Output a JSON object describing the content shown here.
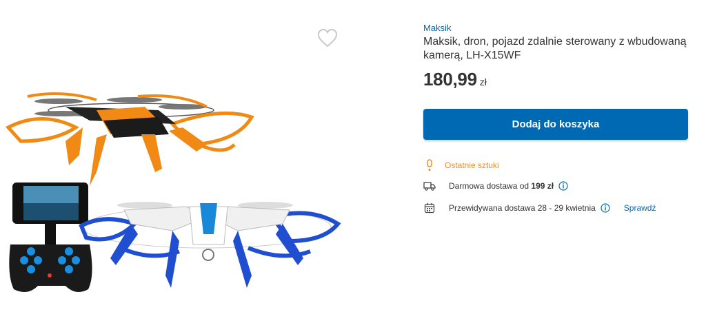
{
  "product": {
    "brand": "Maksik",
    "title": "Maksik, dron, pojazd zdalnie sterowany z wbudowaną kamerą, LH-X15WF",
    "price": "180,99",
    "currency": "zł"
  },
  "actions": {
    "add_to_cart": "Dodaj do koszyka"
  },
  "availability": {
    "stock_label": "Ostatnie sztuki"
  },
  "shipping": {
    "free_prefix": "Darmowa dostawa od",
    "free_threshold": "199 zł",
    "expected_label": "Przewidywana dostawa 28 - 29 kwietnia",
    "check_link": "Sprawdź"
  },
  "colors": {
    "accent": "#0069b4",
    "warning": "#e98c2b",
    "text": "#333333"
  },
  "icons": [
    "heart-icon",
    "exclamation-icon",
    "truck-icon",
    "calendar-icon",
    "info-icon"
  ]
}
